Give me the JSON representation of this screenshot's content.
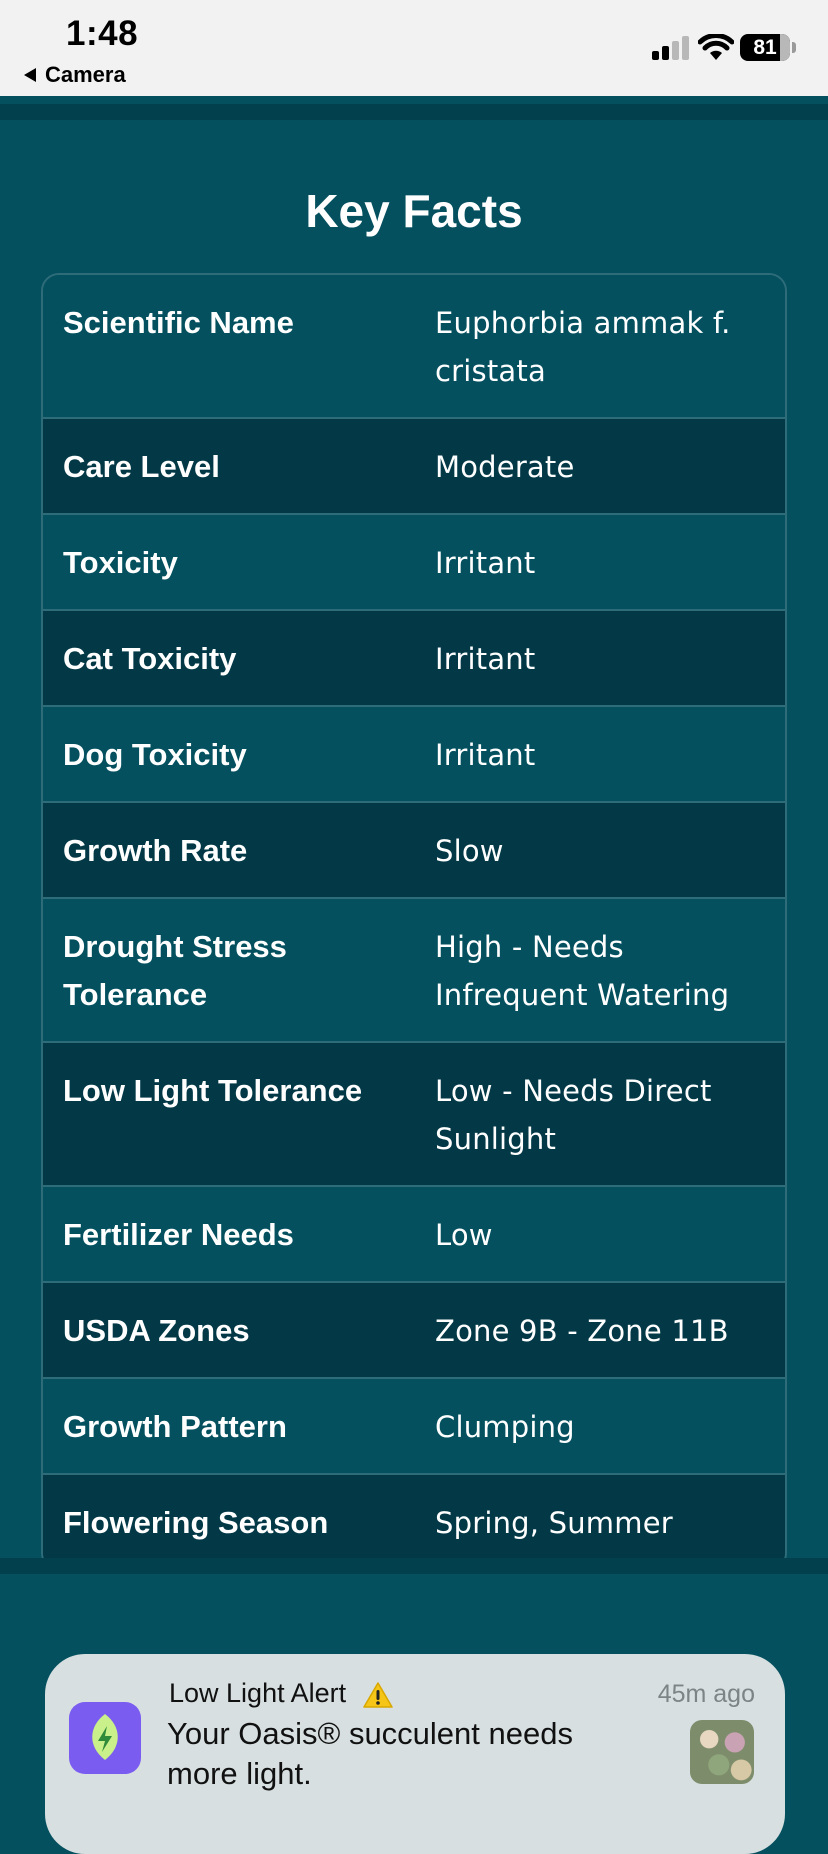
{
  "status_bar": {
    "time": "1:48",
    "back_label": "Camera",
    "battery_level": "81",
    "icons": [
      "signal-icon",
      "wifi-icon",
      "battery-icon"
    ]
  },
  "key_facts": {
    "title": "Key Facts",
    "rows": [
      {
        "label": "Scientific Name",
        "value": "Euphorbia ammak f. cristata"
      },
      {
        "label": "Care Level",
        "value": "Moderate"
      },
      {
        "label": "Toxicity",
        "value": "Irritant"
      },
      {
        "label": "Cat Toxicity",
        "value": "Irritant"
      },
      {
        "label": "Dog Toxicity",
        "value": "Irritant"
      },
      {
        "label": "Growth Rate",
        "value": "Slow"
      },
      {
        "label": "Drought Stress Tolerance",
        "value": "High - Needs Infrequent Watering"
      },
      {
        "label": "Low Light Tolerance",
        "value": "Low - Needs Direct Sunlight"
      },
      {
        "label": "Fertilizer Needs",
        "value": "Low"
      },
      {
        "label": "USDA Zones",
        "value": "Zone 9B - Zone 11B"
      },
      {
        "label": "Growth Pattern",
        "value": "Clumping"
      },
      {
        "label": "Flowering Season",
        "value": "Spring, Summer"
      }
    ]
  },
  "notification": {
    "title": "Low Light Alert",
    "time": "45m ago",
    "body": "Your Oasis® succulent needs more light.",
    "icons": [
      "app-leaf-icon",
      "warning-icon",
      "plant-thumbnail"
    ]
  },
  "colors": {
    "background": "#04505f",
    "row_alt": "#033947",
    "border": "#2e6c79",
    "app_icon": "#7b5cf0"
  }
}
